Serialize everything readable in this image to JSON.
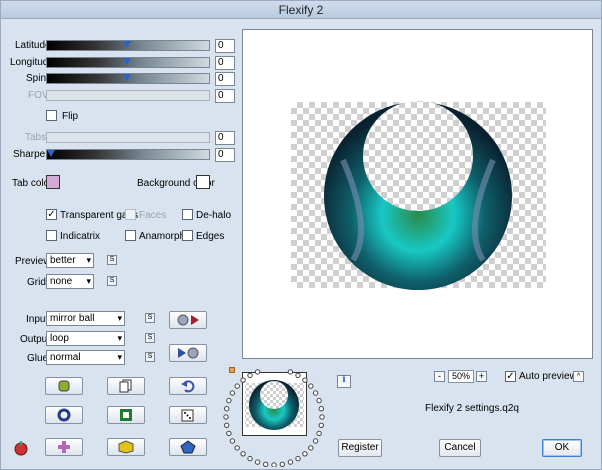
{
  "window": {
    "title": "Flexify 2"
  },
  "sliders": [
    {
      "key": "latitude",
      "label": "Latitude",
      "value": "0",
      "enabled": true
    },
    {
      "key": "longitude",
      "label": "Longitude",
      "value": "0",
      "enabled": true
    },
    {
      "key": "spin",
      "label": "Spin",
      "value": "0",
      "enabled": true
    },
    {
      "key": "fov",
      "label": "FOV",
      "value": "0",
      "enabled": false
    },
    {
      "key": "tabs",
      "label": "Tabs",
      "value": "0",
      "enabled": false
    },
    {
      "key": "sharpen",
      "label": "Sharpen",
      "value": "0",
      "enabled": true
    }
  ],
  "flip": {
    "label": "Flip",
    "checked": false
  },
  "colors": {
    "tab_label": "Tab color",
    "tab_value": "#d4a9d8",
    "bg_label": "Background color",
    "bg_value": "#ffffff"
  },
  "options": {
    "transparent_gaps": {
      "label": "Transparent gaps",
      "checked": true
    },
    "faces": {
      "label": "Faces",
      "checked": false
    },
    "de_halo": {
      "label": "De-halo",
      "checked": false
    },
    "indicatrix": {
      "label": "Indicatrix",
      "checked": false
    },
    "anamorph": {
      "label": "Anamorph",
      "checked": false
    },
    "edges": {
      "label": "Edges",
      "checked": false
    }
  },
  "preview_quality": {
    "label": "Preview",
    "value": "better"
  },
  "grid": {
    "label": "Grid",
    "value": "none"
  },
  "input": {
    "label": "Input",
    "value": "mirror ball"
  },
  "output": {
    "label": "Output",
    "value": "loop"
  },
  "glue": {
    "label": "Glue",
    "value": "normal"
  },
  "s_button": "S",
  "zoom": {
    "minus": "-",
    "value": "50%",
    "plus": "+"
  },
  "auto_preview": {
    "label": "Auto preview",
    "checked": true
  },
  "settings_file": "Flexify 2 settings.q2q",
  "info_label": "i",
  "buttons": {
    "register": "Register",
    "cancel": "Cancel",
    "ok": "OK"
  },
  "accent_color": "#2a62c9"
}
